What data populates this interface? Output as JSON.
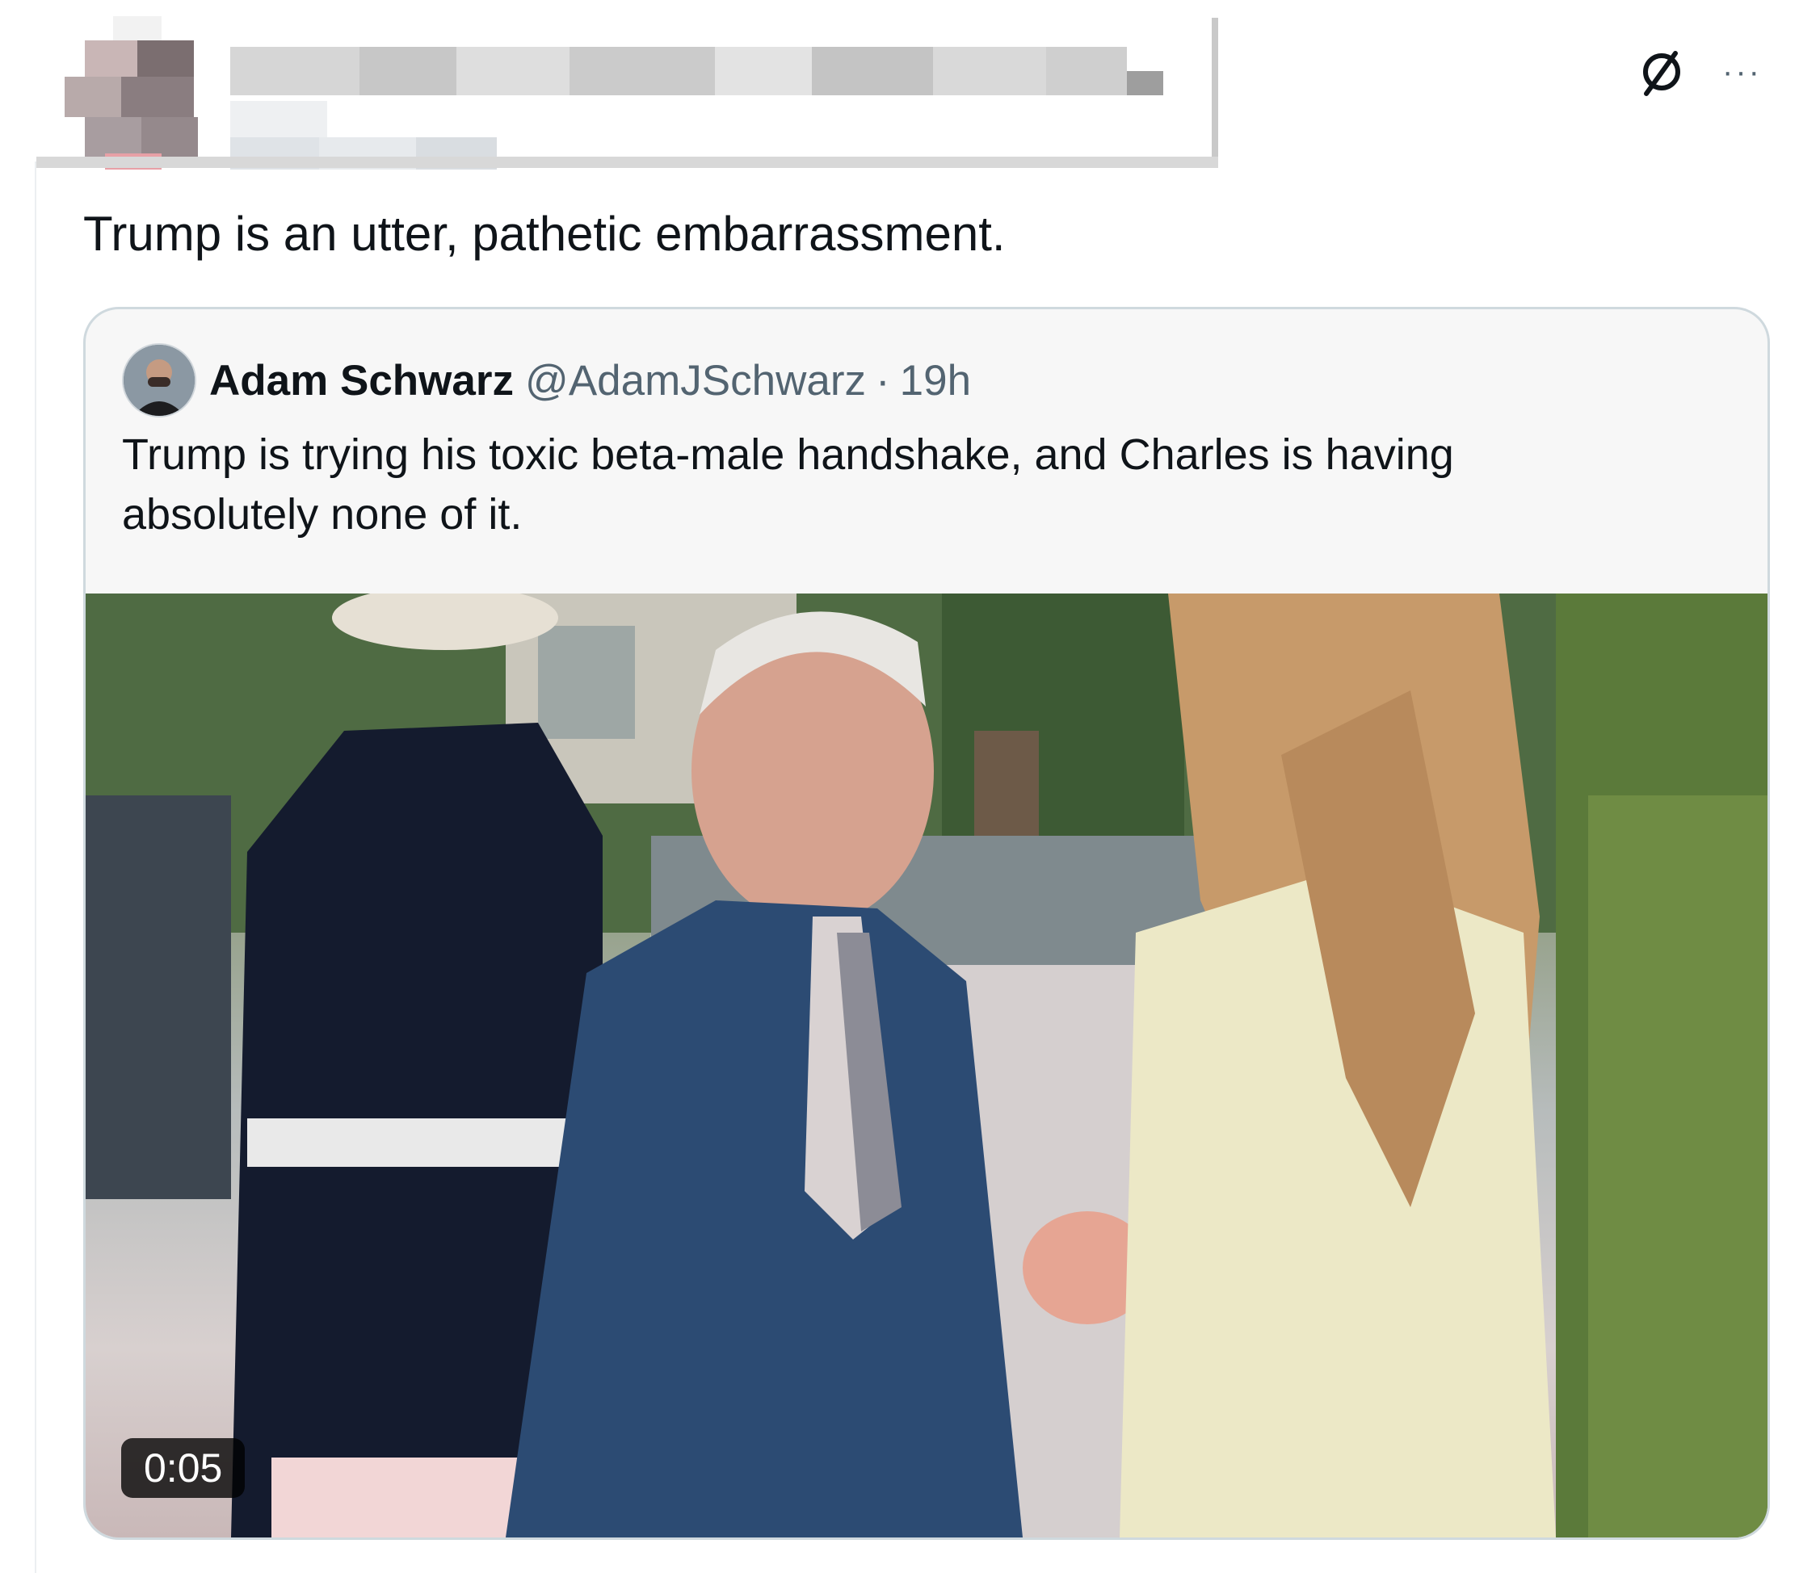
{
  "post": {
    "text": "Trump is an utter, pathetic embarrassment."
  },
  "top_actions": {
    "grok_icon": "grok-icon",
    "more_label": "···"
  },
  "quote": {
    "name": "Adam Schwarz",
    "handle": "@AdamJSchwarz",
    "separator": "·",
    "time": "19h",
    "text": "Trump is trying his toxic beta-male handshake, and Charles is having absolutely none of it.",
    "video": {
      "duration": "0:05"
    }
  },
  "colors": {
    "text": "#0f1419",
    "secondary": "#536471",
    "card_border": "#cfd9de",
    "card_bg": "#f7f7f7"
  }
}
